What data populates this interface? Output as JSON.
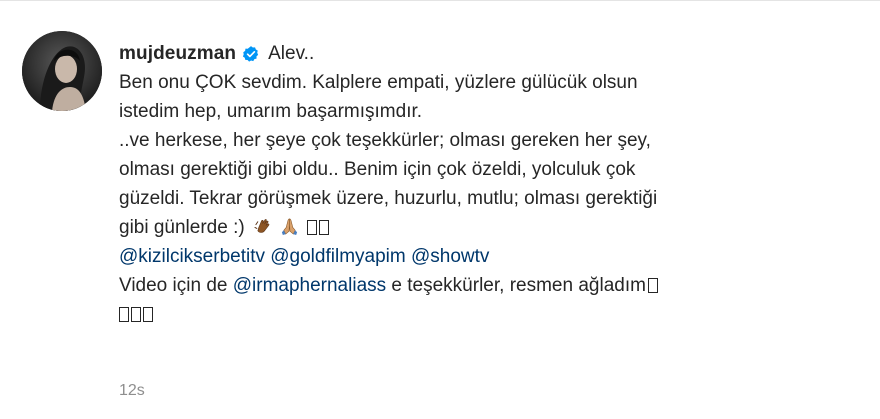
{
  "comment": {
    "username": "mujdeuzman",
    "verified": true,
    "first_line": "Alev..",
    "lines": [
      "Ben onu ÇOK sevdim. Kalplere empati, yüzlere gülücük olsun",
      "istedim hep, umarım başarmışımdır.",
      "..ve herkese, her şeye çok teşekkürler; olması gereken her şey,",
      "olması gerektiği gibi oldu.. Benim için çok özeldi, yolculuk çok",
      "güzeldi. Tekrar görüşmek üzere, huzurlu, mutlu; olması gerektiği"
    ],
    "line6_text": "gibi günlerde :)",
    "emoji_names": [
      "clapping-hands-emoji",
      "folded-hands-emoji"
    ],
    "mentions": [
      "@kizilcikserbetitv",
      "@goldfilmyapim",
      "@showtv"
    ],
    "video_prefix": "Video için de",
    "video_mention": "@irmaphernaliass",
    "video_suffix": "e teşekkürler, resmen ağladım",
    "time": "12s"
  },
  "colors": {
    "text": "#262626",
    "mention": "#00376b",
    "meta": "#8e8e8e",
    "verified": "#0095f6"
  }
}
